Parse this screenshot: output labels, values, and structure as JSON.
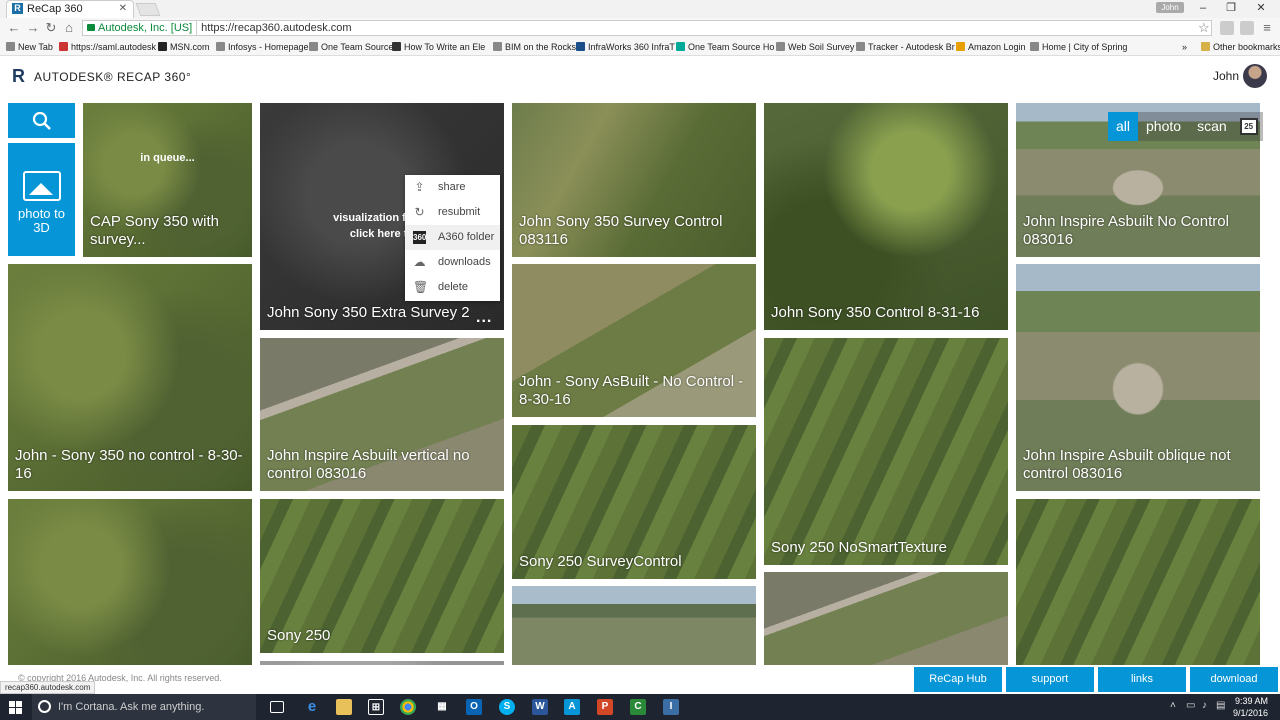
{
  "browser": {
    "tab_title": "ReCap 360",
    "user_pill": "John",
    "secure_label": "Autodesk, Inc. [US]",
    "url": "https://recap360.autodesk.com",
    "bookmarks": [
      "New Tab",
      "https://saml.autodesk",
      "MSN.com",
      "Infosys - Homepage",
      "One Team Source",
      "How To Write an Ele",
      "BIM on the Rocks",
      "InfraWorks 360 InfraT",
      "One Team Source Ho",
      "Web Soil Survey",
      "Tracker - Autodesk Br",
      "Amazon Login",
      "Home | City of Spring"
    ],
    "other_bookmarks": "Other bookmarks",
    "status_url": "recap360.autodesk.com"
  },
  "app": {
    "logo_text": "AUTODESK® RECAP 360°",
    "user_name": "John",
    "photo_to_3d": "photo to 3D",
    "filters": [
      "all",
      "photo",
      "scan"
    ],
    "calendar_day": "25"
  },
  "tiles": {
    "t1": {
      "label": "CAP Sony 350 with survey...",
      "status": "in queue..."
    },
    "t2": {
      "label": "John Sony 350 Extra Survey 2",
      "status_line1": "visualization failed",
      "status_line2": "click here to"
    },
    "t3": {
      "label": "John Sony 350 Survey Control 083116"
    },
    "t4": {
      "label": "John Sony 350 Control 8-31-16"
    },
    "t5": {
      "label": "John Inspire Asbuilt No Control 083016"
    },
    "t6": {
      "label": "John - Sony 350 no control - 8-30-16"
    },
    "t7": {
      "label": "John Inspire Asbuilt vertical no control 083016"
    },
    "t8": {
      "label": "John - Sony AsBuilt - No Control - 8-30-16"
    },
    "t9": {
      "label": "John Inspire Asbuilt oblique not control 083016"
    },
    "t10": {
      "label": "Sony 250 SurveyControl"
    },
    "t11": {
      "label": "Sony 250 NoSmartTexture"
    },
    "t12": {
      "label": "Sony 250"
    }
  },
  "context_menu": {
    "items": [
      {
        "label": "share",
        "icon": "share-icon"
      },
      {
        "label": "resubmit",
        "icon": "refresh-icon"
      },
      {
        "label": "A360 folder",
        "icon": "a360-icon"
      },
      {
        "label": "downloads",
        "icon": "cloud-download-icon"
      },
      {
        "label": "delete",
        "icon": "trash-icon"
      }
    ],
    "more_dots": "..."
  },
  "footer": {
    "copyright": "© copyright 2016 Autodesk, Inc. All rights reserved.",
    "buttons": [
      "ReCap Hub",
      "support",
      "links",
      "download"
    ]
  },
  "taskbar": {
    "cortana_placeholder": "I'm Cortana. Ask me anything.",
    "time": "9:39 AM",
    "date": "9/1/2016"
  },
  "colors": {
    "accent": "#0696d7",
    "taskbar": "#1f2530"
  }
}
